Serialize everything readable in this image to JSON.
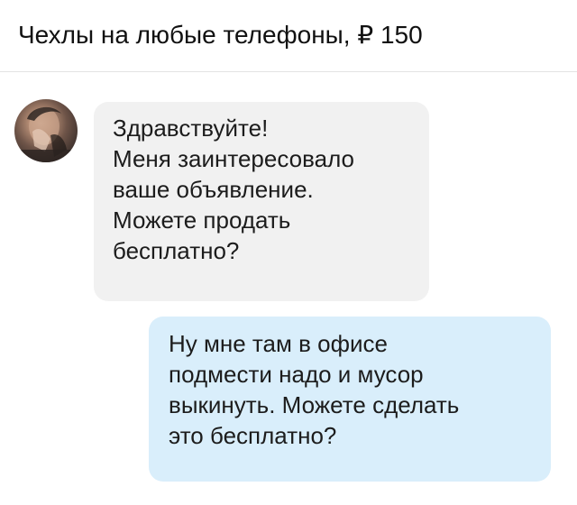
{
  "header": {
    "title": "Чехлы на любые телефоны, ₽ 150"
  },
  "chat": {
    "messages": [
      {
        "direction": "incoming",
        "avatar_icon": "user-avatar-photo",
        "lines": [
          "Здравствуйте!",
          "Меня заинтересовало",
          "ваше объявление.",
          "Можете продать",
          "бесплатно?"
        ]
      },
      {
        "direction": "outgoing",
        "lines": [
          "Ну мне там в офисе",
          "подмести надо и мусор",
          "выкинуть. Можете сделать",
          "это бесплатно?"
        ]
      }
    ]
  },
  "colors": {
    "incoming_bubble": "#f1f1f1",
    "outgoing_bubble": "#d9eefb",
    "divider": "#e3e3e3",
    "text": "#1c1c1c"
  }
}
